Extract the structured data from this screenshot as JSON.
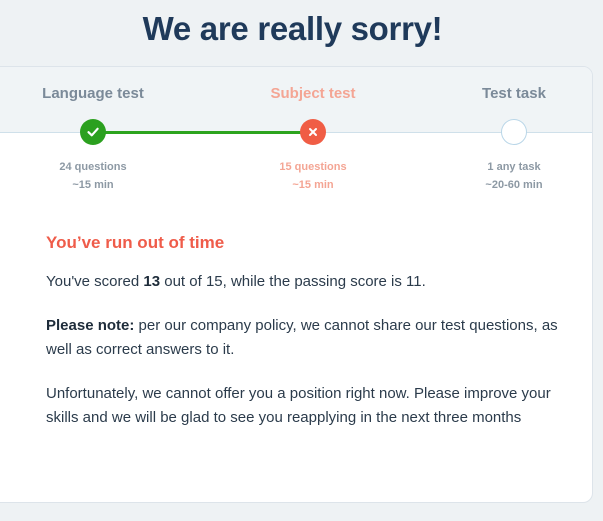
{
  "title": "We are really sorry!",
  "steps": [
    {
      "label": "Language test",
      "status": "passed",
      "questions": "24 questions",
      "duration": "~15 min",
      "icon": "check-icon"
    },
    {
      "label": "Subject test",
      "status": "failed",
      "questions": "15 questions",
      "duration": "~15 min",
      "icon": "cross-icon"
    },
    {
      "label": "Test task",
      "status": "pending",
      "questions": "1 any task",
      "duration": "~20-60 min",
      "icon": "empty-circle"
    }
  ],
  "colors": {
    "passed": "#2ba01f",
    "failed": "#f05d45",
    "title": "#1f3a5a",
    "heading": "#ef5c4a"
  },
  "result": {
    "heading": "You’ve run out of time",
    "score_prefix": "You've scored ",
    "score_value": "13",
    "score_suffix": " out of 15, while the passing score is 11.",
    "note_label": "Please note:",
    "note_text": " per our company policy, we cannot share our test questions, as well as correct answers to it.",
    "closing": "Unfortunately, we cannot offer you a position right now. Please improve your skills and we will be glad to see you reapplying in the next three months"
  }
}
